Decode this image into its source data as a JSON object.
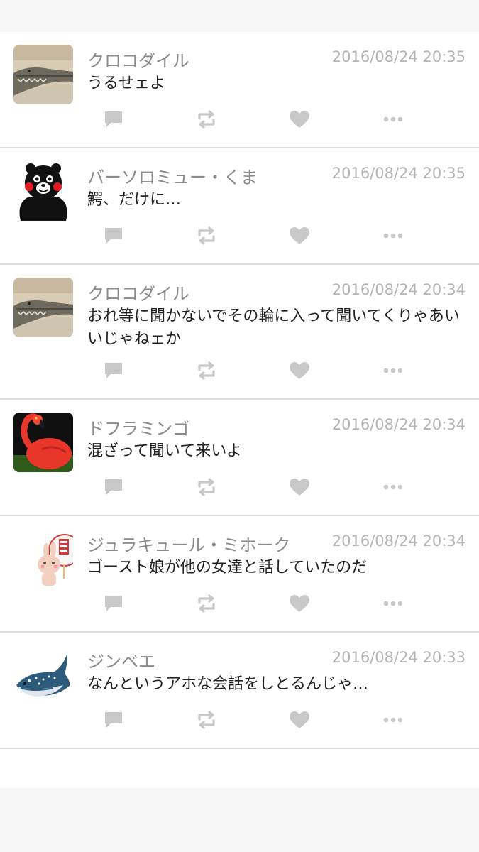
{
  "posts": [
    {
      "name": "クロコダイル",
      "time": "2016/08/24 20:35",
      "text": "うるせェよ",
      "avatar_icon": "crocodile-avatar-icon"
    },
    {
      "name": "バーソロミュー・くま",
      "time": "2016/08/24 20:35",
      "text": "鰐、だけに…",
      "avatar_icon": "kumamon-avatar-icon"
    },
    {
      "name": "クロコダイル",
      "time": "2016/08/24 20:34",
      "text": "おれ等に聞かないでその輪に入って聞いてくりゃあいいじゃねェか",
      "avatar_icon": "crocodile-avatar-icon"
    },
    {
      "name": "ドフラミンゴ",
      "time": "2016/08/24 20:34",
      "text": "混ざって聞いて来いよ",
      "avatar_icon": "flamingo-avatar-icon"
    },
    {
      "name": "ジュラキュール・ミホーク",
      "time": "2016/08/24 20:34",
      "text": "ゴースト娘が他の女達と話していたのだ",
      "avatar_icon": "rabbit-fan-avatar-icon"
    },
    {
      "name": "ジンベエ",
      "time": "2016/08/24 20:33",
      "text": "なんというアホな会話をしとるんじゃ…",
      "avatar_icon": "whale-shark-avatar-icon"
    }
  ],
  "action_icons": [
    "reply-icon",
    "retweet-icon",
    "like-icon",
    "more-icon"
  ],
  "colors": {
    "background": "#f5f5f5",
    "card": "#ffffff",
    "name": "#8a8a8a",
    "time": "#b4b4b4",
    "text": "#222222",
    "icon": "#c8c8c8",
    "divider": "#dcdcdc"
  }
}
